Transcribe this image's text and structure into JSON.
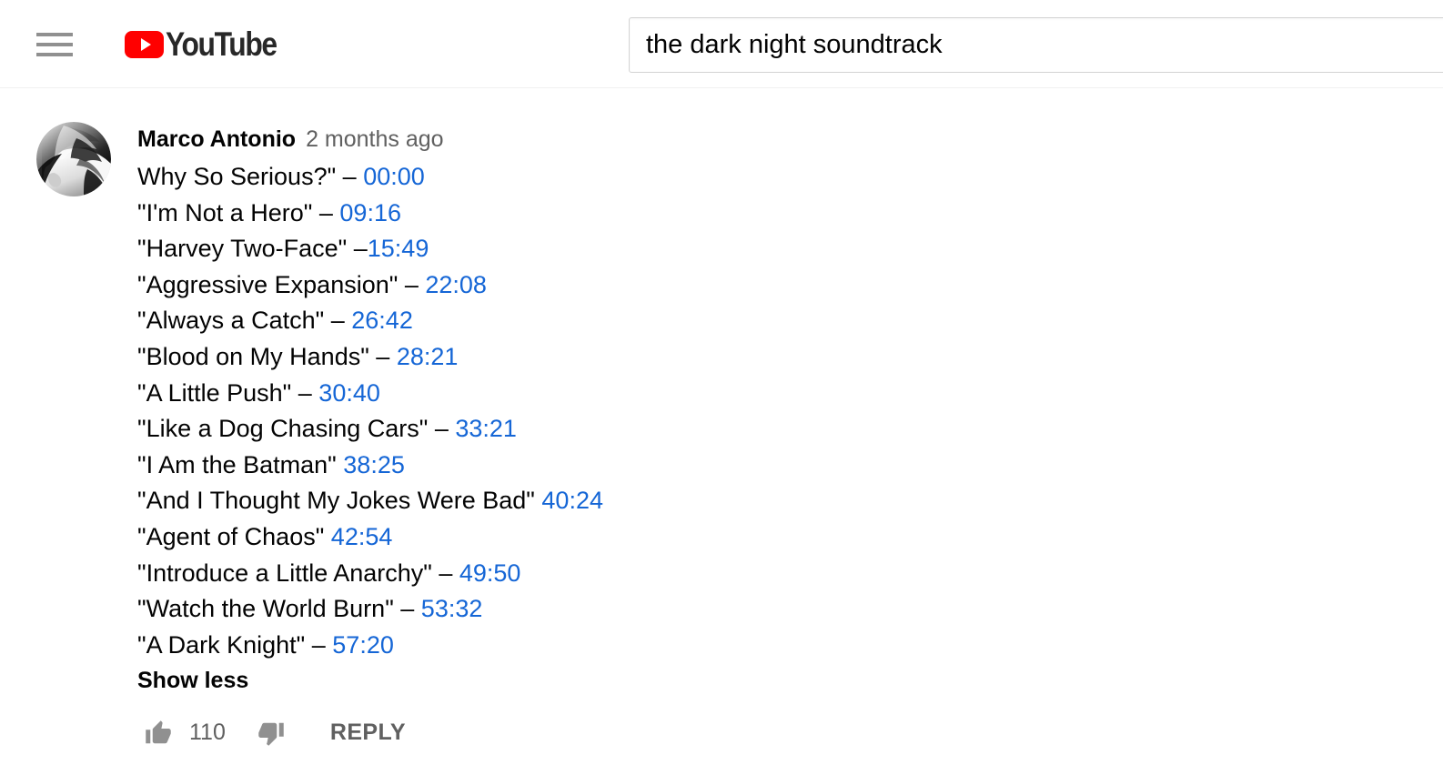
{
  "masthead": {
    "guide_button_label": "Guide",
    "guide_icon": "hamburger-menu-icon",
    "logo": {
      "icon": "youtube-play-icon",
      "wordmark": "YouTube"
    },
    "search": {
      "value": "the dark night soundtrack",
      "placeholder": "Search"
    }
  },
  "comment": {
    "avatar": {
      "icon": "user-avatar-photo",
      "alt": "Marco Antonio avatar"
    },
    "author": "Marco Antonio",
    "published_time": "2 months ago",
    "lines": [
      {
        "text": "Why So Serious?\" – ",
        "timestamp": "00:00"
      },
      {
        "text": "\"I'm Not a Hero\" – ",
        "timestamp": "09:16"
      },
      {
        "text": "\"Harvey Two-Face\" –",
        "timestamp": "15:49"
      },
      {
        "text": "\"Aggressive Expansion\" – ",
        "timestamp": "22:08"
      },
      {
        "text": "\"Always a Catch\" – ",
        "timestamp": "26:42"
      },
      {
        "text": "\"Blood on My Hands\" – ",
        "timestamp": "28:21"
      },
      {
        "text": "\"A Little Push\" – ",
        "timestamp": "30:40"
      },
      {
        "text": "\"Like a Dog Chasing Cars\" – ",
        "timestamp": "33:21"
      },
      {
        "text": "\"I Am the Batman\" ",
        "timestamp": "38:25"
      },
      {
        "text": "\"And I Thought My Jokes Were Bad\" ",
        "timestamp": "40:24"
      },
      {
        "text": "\"Agent of Chaos\" ",
        "timestamp": "42:54"
      },
      {
        "text": "\"Introduce a Little Anarchy\" – ",
        "timestamp": "49:50"
      },
      {
        "text": "\"Watch the World Burn\" – ",
        "timestamp": "53:32"
      },
      {
        "text": "\"A Dark Knight\" – ",
        "timestamp": "57:20"
      }
    ],
    "expander_label": "Show less",
    "actions": {
      "like_icon": "thumb-up-icon",
      "vote_count": "110",
      "dislike_icon": "thumb-down-icon",
      "reply_label": "REPLY"
    }
  },
  "colors": {
    "brand_red": "#ff0000",
    "link_blue": "#1566d6",
    "text_primary": "#030303",
    "text_secondary": "#606060",
    "icon_gray": "#909090",
    "divider": "#f1f1f1"
  }
}
